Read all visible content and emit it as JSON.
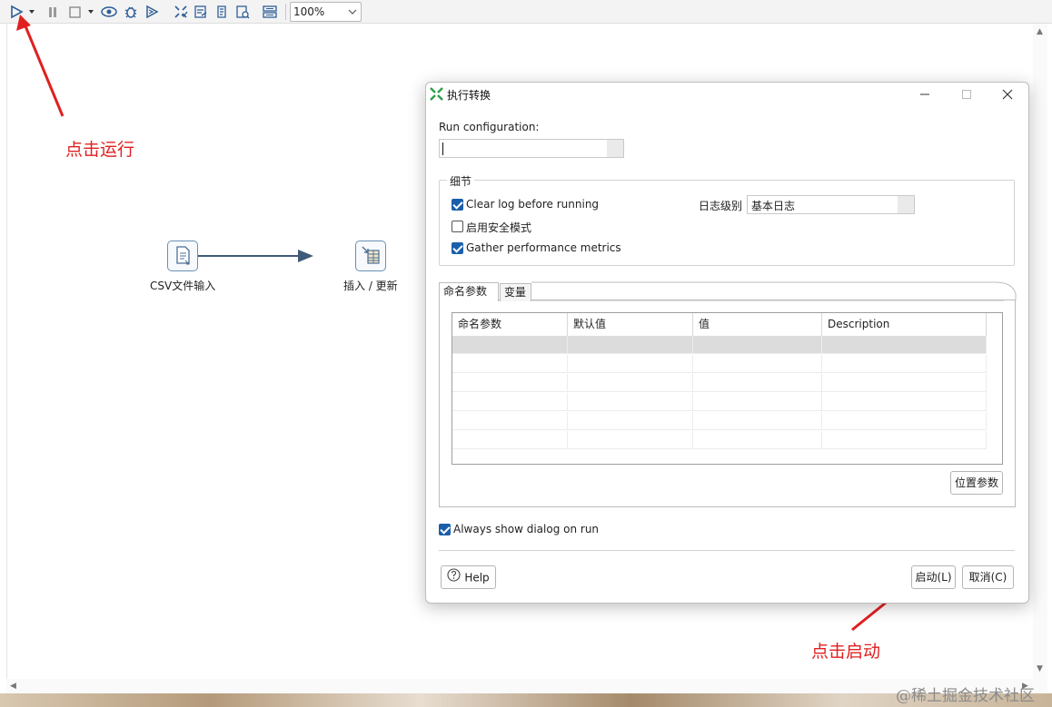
{
  "toolbar": {
    "icons": [
      "run-icon",
      "run-dropdown-icon",
      "pause-icon",
      "stop-icon",
      "stop-dropdown-icon",
      "preview-icon",
      "debug-icon",
      "replay-icon",
      "verify-icon",
      "impact-icon",
      "sql-icon",
      "explore-db-icon",
      "show-results-icon"
    ],
    "zoom_value": "100%"
  },
  "canvas": {
    "nodes": [
      {
        "label": "CSV文件输入",
        "icon": "csv-input-icon"
      },
      {
        "label": "插入 / 更新",
        "icon": "insert-update-icon"
      }
    ]
  },
  "annotations": {
    "run_hint": "点击运行",
    "start_hint": "点击启动"
  },
  "dialog": {
    "title": "执行转换",
    "run_configuration_label": "Run configuration:",
    "run_configuration_value": "",
    "details_group": "细节",
    "clear_log_label": "Clear log before running",
    "clear_log_checked": true,
    "safe_mode_label": "启用安全模式",
    "safe_mode_checked": false,
    "gather_metrics_label": "Gather performance metrics",
    "gather_metrics_checked": true,
    "log_level_label": "日志级别",
    "log_level_value": "基本日志",
    "tabs": [
      {
        "label": "命名参数",
        "active": true
      },
      {
        "label": "变量",
        "active": false
      }
    ],
    "params_table": {
      "columns": [
        "命名参数",
        "默认值",
        "值",
        "Description"
      ],
      "rows": [
        [
          "",
          "",
          "",
          ""
        ],
        [
          "",
          "",
          "",
          ""
        ],
        [
          "",
          "",
          "",
          ""
        ],
        [
          "",
          "",
          "",
          ""
        ],
        [
          "",
          "",
          "",
          ""
        ],
        [
          "",
          "",
          "",
          ""
        ]
      ]
    },
    "position_params_button": "位置参数",
    "always_show_label": "Always show dialog on run",
    "always_show_checked": true,
    "help_button": "Help",
    "start_button": "启动(L)",
    "cancel_button": "取消(C)"
  },
  "watermark": "@稀土掘金技术社区",
  "colors": {
    "annotation": "#e02020",
    "checkbox_checked": "#1b5faa",
    "hop_line": "#3f5a78",
    "node_border": "#6a8fb5"
  }
}
